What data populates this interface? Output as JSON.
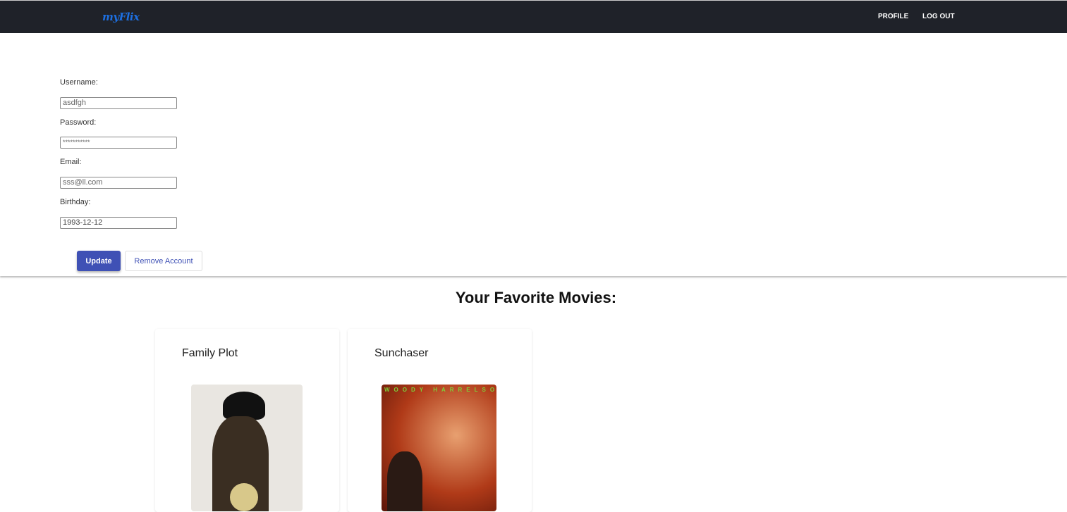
{
  "nav": {
    "logo": "myFlix",
    "profile": "PROFILE",
    "logout": "LOG OUT"
  },
  "form": {
    "username_label": "Username:",
    "username_value": "asdfgh",
    "password_label": "Password:",
    "password_value": "***********",
    "email_label": "Email:",
    "email_value": "sss@ll.com",
    "birthday_label": "Birthday:",
    "birthday_value": "1993-12-12",
    "update": "Update",
    "remove": "Remove Account"
  },
  "favorites": {
    "heading": "Your Favorite Movies:",
    "movies": [
      {
        "title": "Family Plot"
      },
      {
        "title": "Sunchaser",
        "poster_text": "WOODY HARRELSON"
      }
    ]
  }
}
